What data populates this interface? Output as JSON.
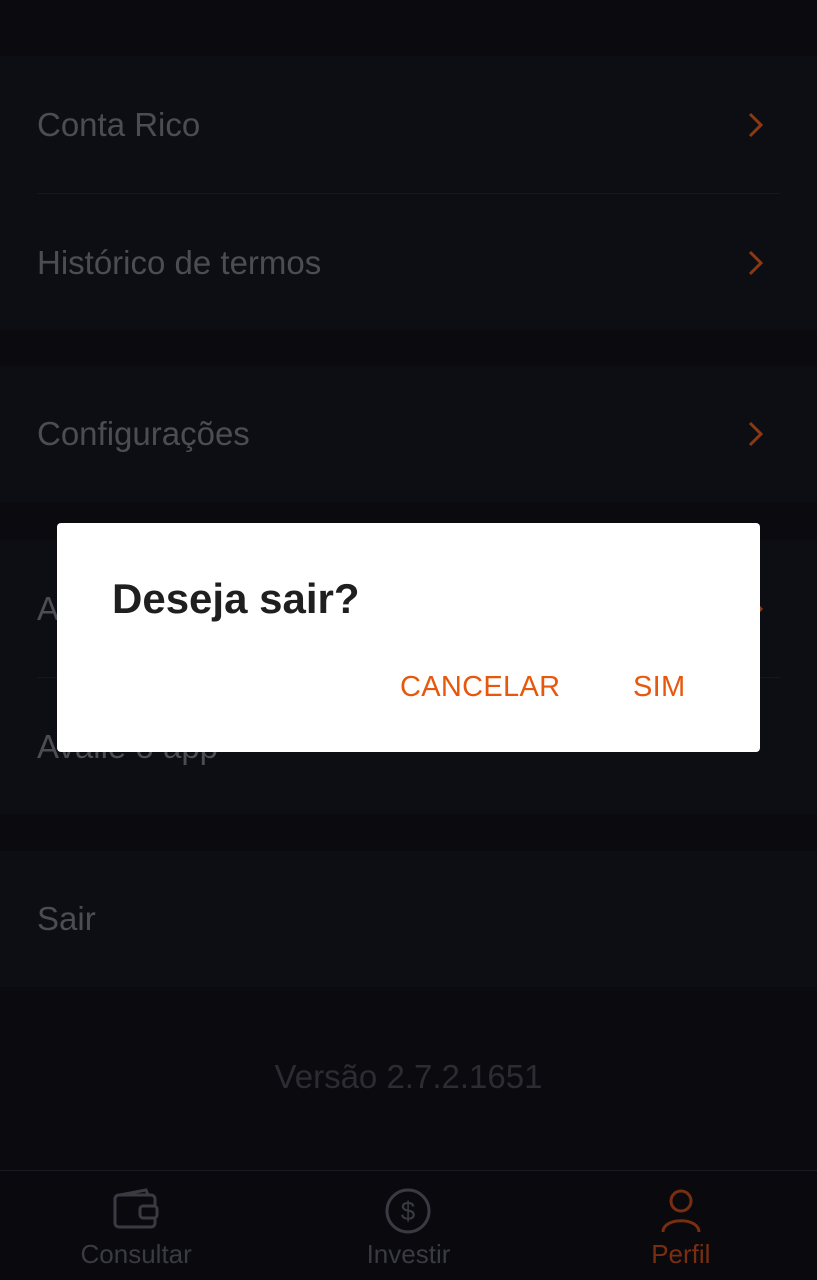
{
  "menu": {
    "section1": [
      {
        "label": "Conta Rico"
      },
      {
        "label": "Histórico de termos"
      }
    ],
    "section2": [
      {
        "label": "Configurações"
      }
    ],
    "section3": [
      {
        "label": "A"
      },
      {
        "label": "Avalie o app"
      }
    ],
    "section4": [
      {
        "label": "Sair"
      }
    ]
  },
  "version": "Versão 2.7.2.1651",
  "tabbar": {
    "tabs": [
      {
        "label": "Consultar",
        "icon": "wallet-icon"
      },
      {
        "label": "Investir",
        "icon": "dollar-coin-icon"
      },
      {
        "label": "Perfil",
        "icon": "user-icon",
        "active": true
      }
    ]
  },
  "dialog": {
    "title": "Deseja sair?",
    "cancel_label": "CANCELAR",
    "confirm_label": "SIM"
  },
  "colors": {
    "accent": "#e8580c",
    "background": "#0a0a0f",
    "dialog": "#ffffff"
  }
}
